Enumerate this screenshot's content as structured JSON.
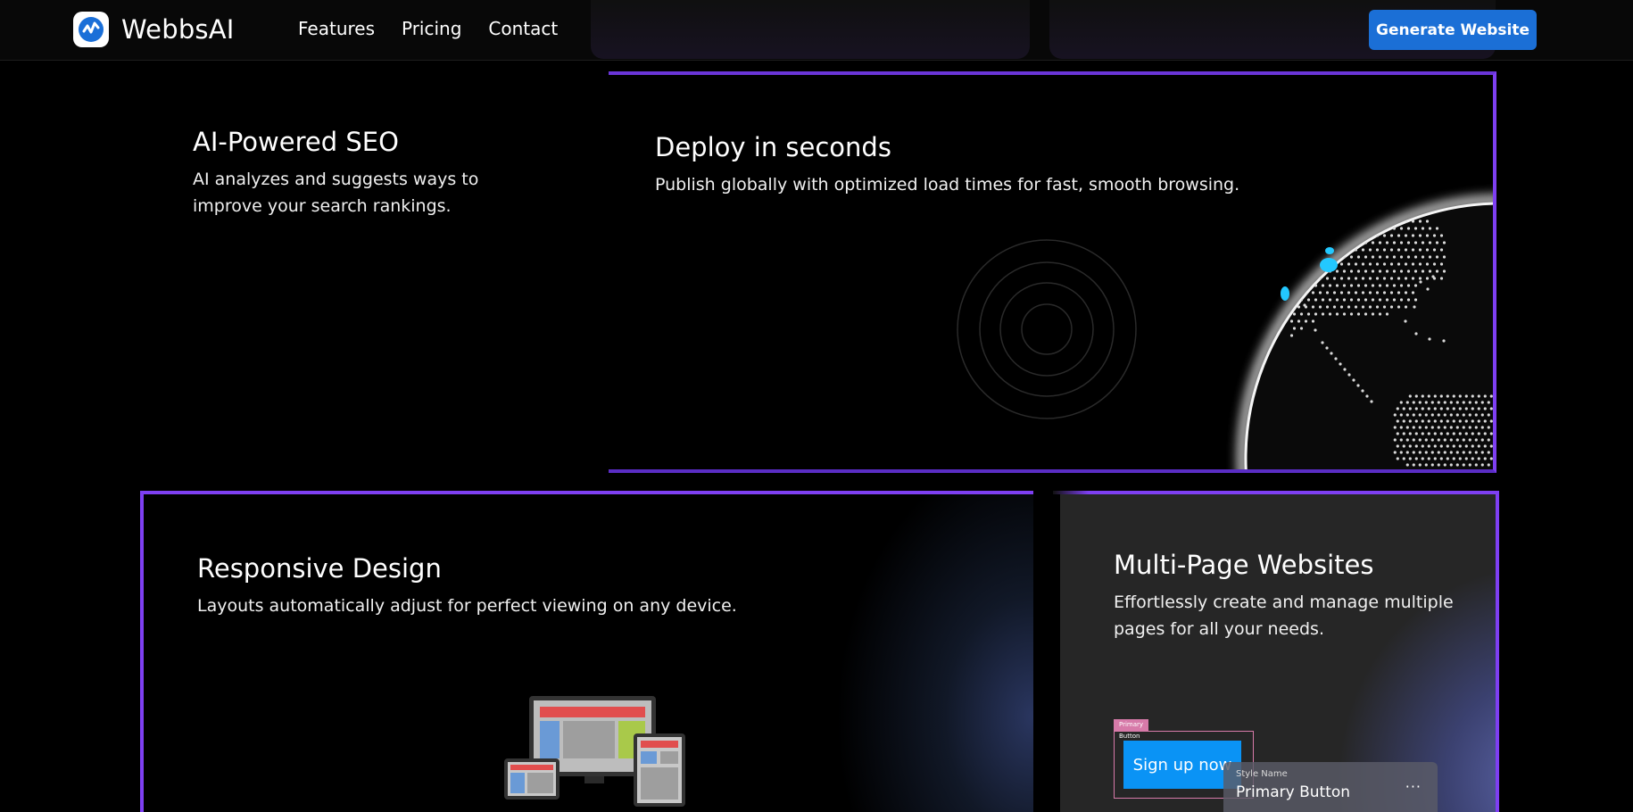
{
  "header": {
    "brand": "WebbsAI",
    "nav": [
      {
        "label": "Features"
      },
      {
        "label": "Pricing"
      },
      {
        "label": "Contact"
      }
    ],
    "cta_label": "Generate Website"
  },
  "cards": {
    "seo": {
      "title": "AI-Powered SEO",
      "description": "AI analyzes and suggests ways to improve your search rankings."
    },
    "deploy": {
      "title": "Deploy in seconds",
      "description": "Publish globally with optimized load times for fast, smooth browsing."
    },
    "responsive": {
      "title": "Responsive Design",
      "description": "Layouts automatically adjust for perfect viewing on any device."
    },
    "multipage": {
      "title": "Multi-Page Websites",
      "description": "Effortlessly create and manage multiple pages for all your needs.",
      "demo": {
        "tag": "Primary Button",
        "button_label": "Sign up now",
        "style_label": "Style Name",
        "style_value": "Primary Button",
        "menu_glyph": "···"
      }
    }
  },
  "colors": {
    "accent_border": "#7e3ff2",
    "cta_bg": "#1b6fd6",
    "signup_bg": "#0a93f5",
    "globe_highlight": "#23c8ff",
    "tag_bg": "#d77aa9"
  },
  "icons": {
    "logo": "webbsai-logo-icon",
    "menu": "more-dots-icon"
  }
}
